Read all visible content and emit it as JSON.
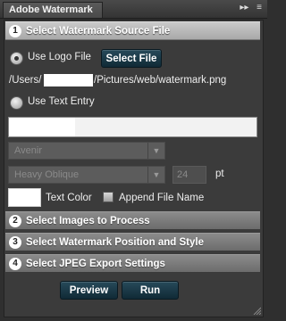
{
  "window": {
    "tab_title": "Adobe Watermark",
    "icons": [
      "double-chevron-right-icon",
      "panel-menu-icon"
    ]
  },
  "sections": [
    {
      "number": "1",
      "label": "Select Watermark Source File"
    },
    {
      "number": "2",
      "label": "Select Images to Process"
    },
    {
      "number": "3",
      "label": "Select Watermark Position and Style"
    },
    {
      "number": "4",
      "label": "Select JPEG Export Settings"
    }
  ],
  "source": {
    "use_logo_label": "Use Logo File",
    "select_file_label": "Select File",
    "path_prefix": "/Users/",
    "path_suffix": "/Pictures/web/watermark.png",
    "use_text_label": "Use Text Entry",
    "text_entry_value": ""
  },
  "text_style": {
    "font_family": "Avenir",
    "font_style": "Heavy Oblique",
    "font_size": "24",
    "size_unit": "pt",
    "text_color_label": "Text Color",
    "text_color": "#ffffff",
    "append_filename_label": "Append File Name",
    "append_filename_checked": false
  },
  "actions": {
    "preview_label": "Preview",
    "run_label": "Run"
  },
  "colors": {
    "button_bg": "#173746",
    "section_active": "#b9b9b9",
    "section_inactive": "#7a7a7a"
  }
}
